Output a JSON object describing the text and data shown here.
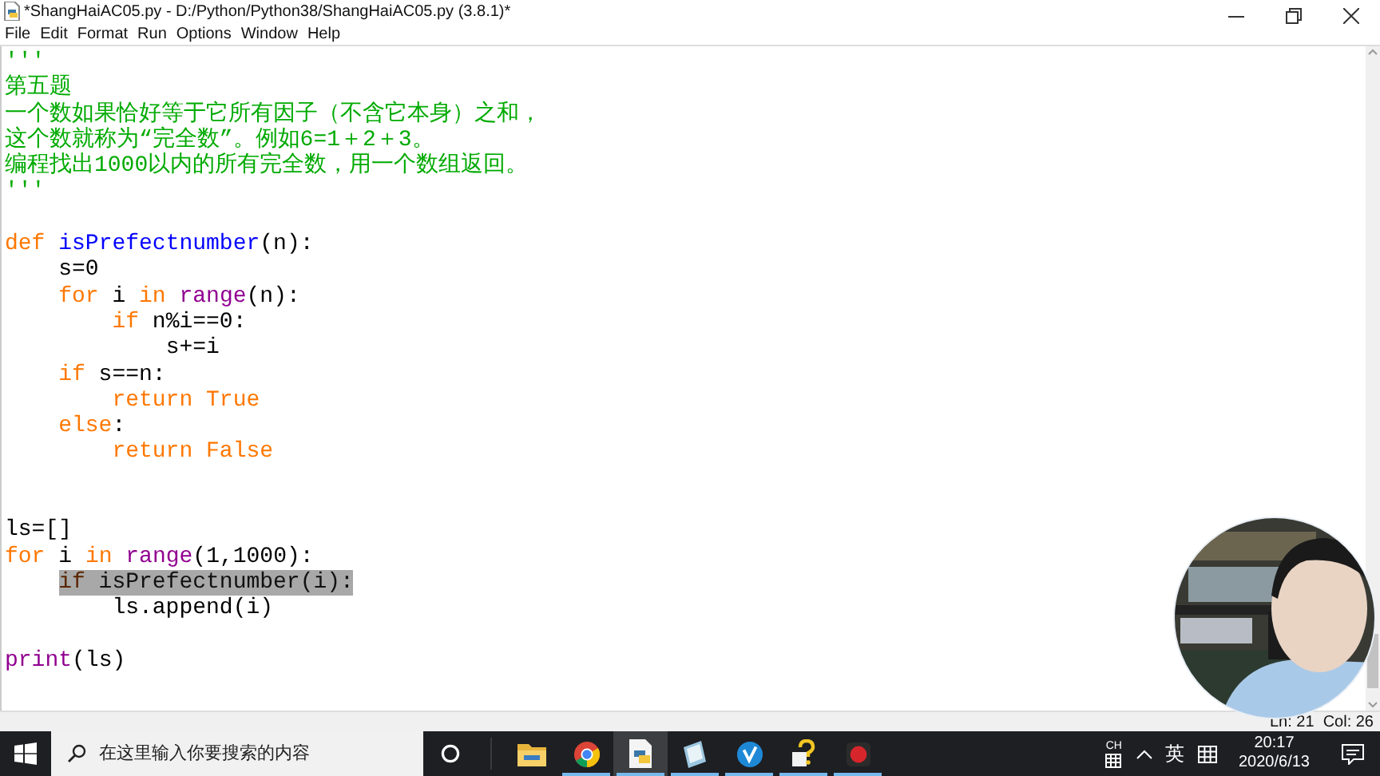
{
  "window": {
    "title": "*ShangHaiAC05.py - D:/Python/Python38/ShangHaiAC05.py (3.8.1)*"
  },
  "menu": [
    "File",
    "Edit",
    "Format",
    "Run",
    "Options",
    "Window",
    "Help"
  ],
  "editor": {
    "lines": [
      {
        "kind": "code",
        "selected": false,
        "tokens": [
          {
            "kind": "string",
            "text": "'''"
          }
        ]
      },
      {
        "kind": "code",
        "selected": false,
        "tokens": [
          {
            "kind": "string",
            "text": "第五题"
          }
        ]
      },
      {
        "kind": "code",
        "selected": false,
        "tokens": [
          {
            "kind": "string",
            "text": "一个数如果恰好等于它所有因子（不含它本身）之和，"
          }
        ]
      },
      {
        "kind": "code",
        "selected": false,
        "tokens": [
          {
            "kind": "string",
            "text": "这个数就称为“完全数”。例如6=1＋2＋3。"
          }
        ]
      },
      {
        "kind": "code",
        "selected": false,
        "tokens": [
          {
            "kind": "string",
            "text": "编程找出1000以内的所有完全数，用一个数组返回。"
          }
        ]
      },
      {
        "kind": "code",
        "selected": false,
        "tokens": [
          {
            "kind": "string",
            "text": "'''"
          }
        ]
      },
      {
        "kind": "blank"
      },
      {
        "kind": "code",
        "selected": false,
        "tokens": [
          {
            "kind": "keyword",
            "text": "def "
          },
          {
            "kind": "definition",
            "text": "isPrefectnumber"
          },
          {
            "kind": "plain",
            "text": "(n):"
          }
        ],
        "children": [
          {
            "kind": "code",
            "selected": false,
            "tokens": [
              {
                "kind": "plain",
                "text": "s=0"
              }
            ]
          },
          {
            "kind": "code",
            "selected": false,
            "tokens": [
              {
                "kind": "keyword",
                "text": "for"
              },
              {
                "kind": "plain",
                "text": " i "
              },
              {
                "kind": "keyword",
                "text": "in "
              },
              {
                "kind": "builtin",
                "text": "range"
              },
              {
                "kind": "plain",
                "text": "(n):"
              }
            ],
            "children": [
              {
                "kind": "code",
                "selected": false,
                "tokens": [
                  {
                    "kind": "keyword",
                    "text": "if"
                  },
                  {
                    "kind": "plain",
                    "text": " n%i==0:"
                  }
                ],
                "children": [
                  {
                    "kind": "code",
                    "selected": false,
                    "tokens": [
                      {
                        "kind": "plain",
                        "text": "s+=i"
                      }
                    ]
                  }
                ]
              }
            ]
          },
          {
            "kind": "code",
            "selected": false,
            "tokens": [
              {
                "kind": "keyword",
                "text": "if"
              },
              {
                "kind": "plain",
                "text": " s==n:"
              }
            ],
            "children": [
              {
                "kind": "code",
                "selected": false,
                "tokens": [
                  {
                    "kind": "keyword",
                    "text": "return True"
                  }
                ]
              }
            ]
          },
          {
            "kind": "code",
            "selected": false,
            "tokens": [
              {
                "kind": "keyword",
                "text": "else"
              },
              {
                "kind": "plain",
                "text": ":"
              }
            ],
            "children": [
              {
                "kind": "code",
                "selected": false,
                "tokens": [
                  {
                    "kind": "keyword",
                    "text": "return False"
                  }
                ]
              }
            ]
          }
        ]
      },
      {
        "kind": "blank"
      },
      {
        "kind": "blank"
      },
      {
        "kind": "code",
        "selected": false,
        "tokens": [
          {
            "kind": "plain",
            "text": "ls=[]"
          }
        ]
      },
      {
        "kind": "code",
        "selected": false,
        "tokens": [
          {
            "kind": "keyword",
            "text": "for"
          },
          {
            "kind": "plain",
            "text": " i "
          },
          {
            "kind": "keyword",
            "text": "in "
          },
          {
            "kind": "builtin",
            "text": "range"
          },
          {
            "kind": "plain",
            "text": "(1,1000):"
          }
        ],
        "children": [
          {
            "kind": "code",
            "selected": true,
            "tokens": [
              {
                "kind": "keyword",
                "text": "if"
              },
              {
                "kind": "plain",
                "text": " isPrefectnumber(i):"
              }
            ],
            "children": [
              {
                "kind": "code",
                "selected": false,
                "tokens": [
                  {
                    "kind": "plain",
                    "text": "ls.append(i)"
                  }
                ]
              }
            ]
          }
        ]
      },
      {
        "kind": "blank"
      },
      {
        "kind": "code",
        "selected": false,
        "tokens": [
          {
            "kind": "builtin",
            "text": "print"
          },
          {
            "kind": "plain",
            "text": "(ls)"
          }
        ]
      }
    ]
  },
  "status_bar": {
    "position": "Ln: 21  Col: 26"
  },
  "taskbar": {
    "search": {
      "placeholder": "在这里输入你要搜索的内容"
    },
    "apps": [
      {
        "kind": "folder",
        "running": false,
        "selected": false
      },
      {
        "kind": "browser",
        "running": true,
        "selected": false
      },
      {
        "kind": "document",
        "running": true,
        "selected": true
      },
      {
        "kind": "notebook",
        "running": true,
        "selected": false
      },
      {
        "kind": "check",
        "running": true,
        "selected": false
      },
      {
        "kind": "question",
        "running": true,
        "selected": false
      },
      {
        "kind": "record",
        "running": true,
        "selected": false
      }
    ],
    "tray": {
      "language": "CH",
      "input_mode": "英",
      "time": "20:17",
      "date": "2020/6/13"
    }
  }
}
